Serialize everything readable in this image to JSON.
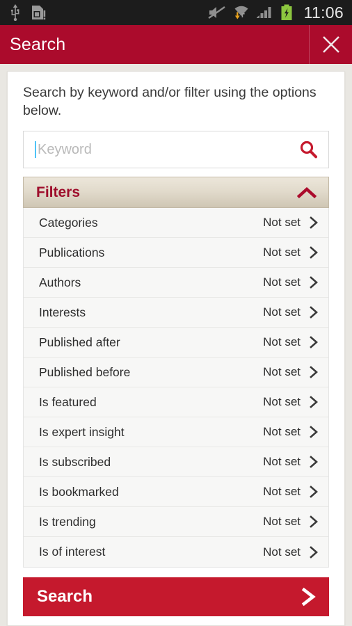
{
  "statusbar": {
    "left_icons": [
      "usb-icon",
      "sd-card-icon"
    ],
    "right_icons": [
      "mute-icon",
      "wifi-download-icon",
      "signal-bars-icon",
      "battery-charging-icon"
    ],
    "clock": "11:06",
    "background_color": "#1c1c1c",
    "battery_color": "#8cc63f"
  },
  "appbar": {
    "title": "Search",
    "close_icon": "close-icon",
    "background_color": "#ab0b2c"
  },
  "main": {
    "intro": "Search by keyword and/or filter using the options below.",
    "keyword": {
      "value": "",
      "placeholder": "Keyword",
      "icon": "search-icon",
      "icon_color": "#c5192d",
      "caret_color": "#4fc3f7"
    },
    "filters": {
      "label": "Filters",
      "expanded": true,
      "chevron_icon": "chevron-up-icon",
      "label_color": "#9e0d2b",
      "rows": [
        {
          "label": "Categories",
          "value": "Not set",
          "chevron": "chevron-right-icon"
        },
        {
          "label": "Publications",
          "value": "Not set",
          "chevron": "chevron-right-icon"
        },
        {
          "label": "Authors",
          "value": "Not set",
          "chevron": "chevron-right-icon"
        },
        {
          "label": "Interests",
          "value": "Not set",
          "chevron": "chevron-right-icon"
        },
        {
          "label": "Published after",
          "value": "Not set",
          "chevron": "chevron-right-icon"
        },
        {
          "label": "Published before",
          "value": "Not set",
          "chevron": "chevron-right-icon"
        },
        {
          "label": "Is featured",
          "value": "Not set",
          "chevron": "chevron-right-icon"
        },
        {
          "label": "Is expert insight",
          "value": "Not set",
          "chevron": "chevron-right-icon"
        },
        {
          "label": "Is subscribed",
          "value": "Not set",
          "chevron": "chevron-right-icon"
        },
        {
          "label": "Is bookmarked",
          "value": "Not set",
          "chevron": "chevron-right-icon"
        },
        {
          "label": "Is trending",
          "value": "Not set",
          "chevron": "chevron-right-icon"
        },
        {
          "label": "Is of interest",
          "value": "Not set",
          "chevron": "chevron-right-icon"
        }
      ]
    },
    "submit": {
      "label": "Search",
      "chevron_icon": "chevron-right-icon",
      "background_color": "#c5192d"
    }
  }
}
